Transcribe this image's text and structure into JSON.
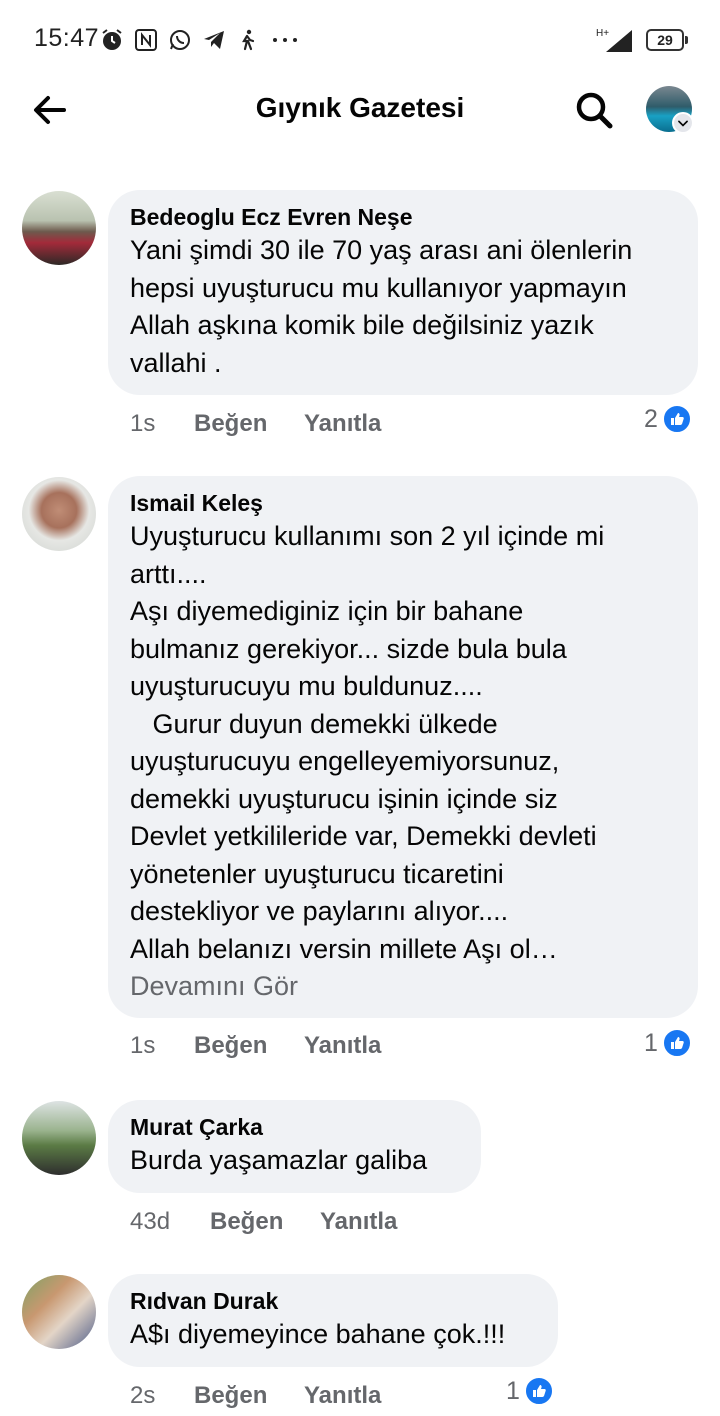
{
  "status_bar": {
    "time": "15:47",
    "network": "H+",
    "battery": "29"
  },
  "header": {
    "title": "Gıynık Gazetesi"
  },
  "actions": {
    "like": "Beğen",
    "reply": "Yanıtla",
    "see_more": "Devamını Gör"
  },
  "comments": [
    {
      "author": "Bedeoglu Ecz Evren Neşe",
      "lines": [
        "Yani şimdi 30 ile 70 yaş arası ani ölenlerin",
        "hepsi uyuşturucu mu kullanıyor yapmayın",
        "Allah aşkına komik bile değilsiniz yazık",
        "vallahi ."
      ],
      "time": "1s",
      "reactions": "2"
    },
    {
      "author": "Ismail Keleş",
      "lines": [
        "Uyuşturucu kullanımı son 2 yıl içinde mi",
        "arttı....",
        "Aşı diyemediginiz için bir bahane",
        "bulmanız gerekiyor... sizde bula bula",
        "uyuşturucuyu mu buldunuz....",
        "   Gurur duyun demekki ülkede",
        "uyuşturucuyu engelleyemiyorsunuz,",
        "demekki uyuşturucu işinin içinde siz",
        "Devlet yetkilileride var, Demekki devleti",
        "yönetenler uyuşturucu ticaretini",
        "destekliyor ve paylarını alıyor....",
        "Allah belanızı versin millete Aşı ol…"
      ],
      "time": "1s",
      "reactions": "1"
    },
    {
      "author": "Murat Çarka",
      "lines": [
        "Burda yaşamazlar galiba"
      ],
      "time": "43d",
      "reactions": ""
    },
    {
      "author": "Rıdvan Durak",
      "lines": [
        "A$ı diyemeyince bahane çok.!!!"
      ],
      "time": "2s",
      "reactions": "1"
    }
  ],
  "icons": {
    "back": "arrow-left-icon",
    "search": "search-icon",
    "like": "thumbs-up-icon"
  },
  "colors": {
    "bubble": "#f0f2f5",
    "like_blue": "#1877f2",
    "meta_gray": "#65676b"
  }
}
